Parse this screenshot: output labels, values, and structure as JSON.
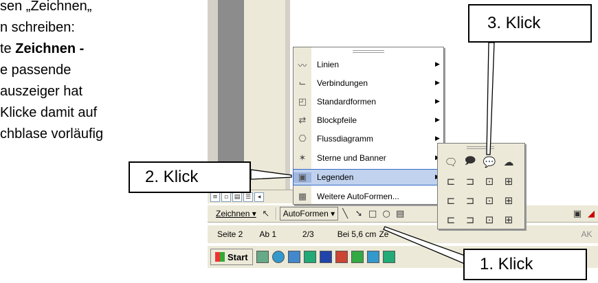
{
  "instructions": {
    "line1": "sen „Zeichnen„",
    "line2": "n schreiben:",
    "line3_prefix": "te ",
    "line3_bold": "Zeichnen -",
    "line4": "e passende",
    "line5": "auszeiger hat",
    "line6": "Klicke damit auf",
    "line7": "chblase vorläufig"
  },
  "annotations": {
    "click1": "1. Klick",
    "click2": "2. Klick",
    "click3": "3. Klick"
  },
  "menu": {
    "items": [
      {
        "label": "Linien",
        "icon": "lines-icon"
      },
      {
        "label": "Verbindungen",
        "icon": "connectors-icon"
      },
      {
        "label": "Standardformen",
        "icon": "basic-shapes-icon"
      },
      {
        "label": "Blockpfeile",
        "icon": "block-arrows-icon"
      },
      {
        "label": "Flussdiagramm",
        "icon": "flowchart-icon"
      },
      {
        "label": "Sterne und Banner",
        "icon": "stars-banners-icon"
      },
      {
        "label": "Legenden",
        "icon": "callouts-icon"
      },
      {
        "label": "Weitere AutoFormen...",
        "icon": "more-autoshapes-icon"
      }
    ],
    "active_index": 6
  },
  "toolbar": {
    "draw_label": "Zeichnen ▾",
    "autoshapes_label": "AutoFormen ▾"
  },
  "status": {
    "page": "Seite 2",
    "section": "Ab 1",
    "pages": "2/3",
    "position": "Bei 5,6 cm",
    "line": "Ze",
    "extra": "AK"
  },
  "taskbar": {
    "start_label": "Start"
  },
  "colors": {
    "menu_highlight": "#c1d2ee",
    "menu_highlight_border": "#316ac5",
    "toolbar_bg": "#ece9d8"
  }
}
